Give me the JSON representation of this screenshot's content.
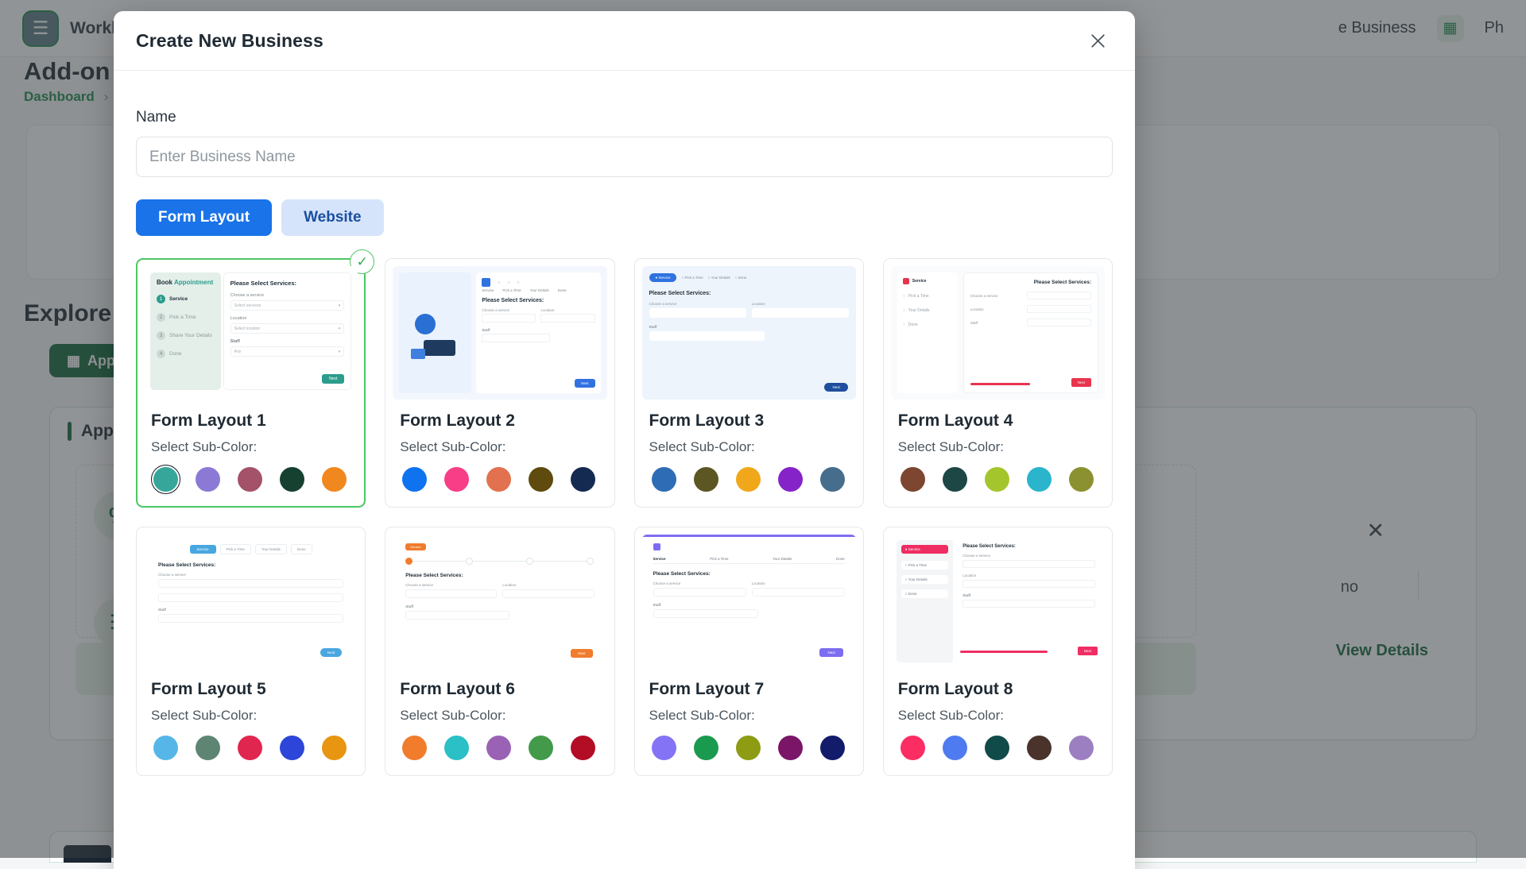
{
  "background": {
    "brand": "Workl",
    "page_title": "Add-on Ma",
    "breadcrumb": "Dashboard",
    "breadcrumb_sep": "›",
    "topbar_link": "e Business",
    "topbar_ph": "Ph",
    "explore_title": "Explore A",
    "pill_label": "Appoi",
    "card_title": "Appointm",
    "badge_1": "%",
    "badge_2": "☰",
    "close_mark": "✕",
    "no_text": "no",
    "view_details": "View Details"
  },
  "modal": {
    "title": "Create New Business",
    "close_icon": "close-icon",
    "name_label": "Name",
    "name_value": "",
    "name_placeholder": "Enter Business Name",
    "tabs": [
      {
        "label": "Form Layout",
        "active": true
      },
      {
        "label": "Website",
        "active": false
      }
    ],
    "selected_check": "✓",
    "sub_color_label": "Select Sub-Color:",
    "layouts": [
      {
        "title": "Form Layout 1",
        "selected": true,
        "selected_swatch_index": 0,
        "swatches": [
          "#36a69a",
          "#8c79d6",
          "#a35269",
          "#16402f",
          "#f1881f"
        ]
      },
      {
        "title": "Form Layout 2",
        "selected": false,
        "selected_swatch_index": -1,
        "swatches": [
          "#0f73f0",
          "#f83e86",
          "#e2714f",
          "#5e4b0d",
          "#152a51"
        ]
      },
      {
        "title": "Form Layout 3",
        "selected": false,
        "selected_swatch_index": -1,
        "swatches": [
          "#2e6cb5",
          "#5b5622",
          "#f0a81a",
          "#8523c9",
          "#476d8c"
        ]
      },
      {
        "title": "Form Layout 4",
        "selected": false,
        "selected_swatch_index": -1,
        "swatches": [
          "#7c4630",
          "#1c4745",
          "#a4c62c",
          "#2ab5cd",
          "#8b9130"
        ]
      },
      {
        "title": "Form Layout 5",
        "selected": false,
        "selected_swatch_index": -1,
        "swatches": [
          "#57b6e8",
          "#5e8573",
          "#e0264f",
          "#2d46d9",
          "#e89512"
        ]
      },
      {
        "title": "Form Layout 6",
        "selected": false,
        "selected_swatch_index": -1,
        "swatches": [
          "#f07c2c",
          "#2bbfc6",
          "#9a62b4",
          "#429a4a",
          "#b30d26"
        ]
      },
      {
        "title": "Form Layout 7",
        "selected": false,
        "selected_swatch_index": -1,
        "swatches": [
          "#8473f5",
          "#1a9a4f",
          "#8d9c12",
          "#7b1568",
          "#131c6b"
        ]
      },
      {
        "title": "Form Layout 8",
        "selected": false,
        "selected_swatch_index": -1,
        "swatches": [
          "#fb2d63",
          "#4f7bf0",
          "#114b49",
          "#4a332b",
          "#9c7fc1"
        ]
      }
    ],
    "thumb_text": {
      "book_appointment_a": "Book ",
      "book_appointment_b": "Appointment",
      "please_select": "Please Select Services:",
      "choose_service": "Choose a service",
      "select_service": "Select services",
      "location": "Location",
      "select_location": "Select location",
      "staff": "Staff",
      "staff_value": "Any",
      "next": "Next",
      "step1": "Service",
      "step2": "Pick a Time",
      "step3": "Share Your Details",
      "step4": "Done"
    }
  }
}
